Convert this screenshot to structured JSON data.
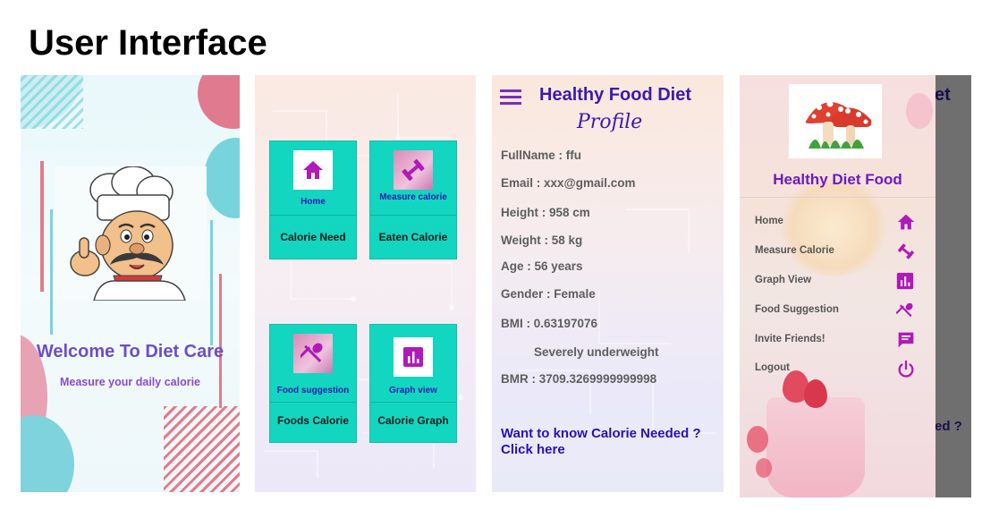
{
  "heading": "User Interface",
  "splash": {
    "welcome": "Welcome To Diet Care",
    "subtitle": "Measure your daily calorie",
    "image_icon": "chef-icon"
  },
  "dashboard": {
    "tiles": [
      {
        "icon": "home-icon",
        "label": "Home",
        "bottom": "Calorie Need"
      },
      {
        "icon": "dumbbell-icon",
        "label": "Measure calorie",
        "bottom": "Eaten Calorie"
      },
      {
        "icon": "fork-spoon-icon",
        "label": "Food suggestion",
        "bottom": "Foods Calorie"
      },
      {
        "icon": "bar-chart-icon",
        "label": "Graph view",
        "bottom": "Calorie Graph"
      }
    ],
    "tile_color": "#12d6c0"
  },
  "profile": {
    "app_title": "Healthy Food Diet",
    "page_title": "Profile",
    "fields": [
      "FullName : ffu",
      "Email :  xxx@gmail.com",
      "Height : 958 cm",
      "Weight : 58 kg",
      "Age : 56 years",
      "Gender :  Female",
      "BMI :  0.63197076",
      "Severely underweight",
      "BMR :  3709.3269999999998"
    ],
    "cta_line1": "Want to know Calorie Needed ?",
    "cta_line2": "Click here"
  },
  "drawer": {
    "logo_icon": "mushroom-icon",
    "title": "Healthy Diet Food",
    "items": [
      {
        "label": "Home",
        "icon": "home-icon"
      },
      {
        "label": "Measure Calorie",
        "icon": "dumbbell-icon"
      },
      {
        "label": "Graph View",
        "icon": "bar-chart-icon"
      },
      {
        "label": "Food Suggestion",
        "icon": "fork-spoon-icon"
      },
      {
        "label": "Invite Friends!",
        "icon": "message-icon"
      },
      {
        "label": "Logout",
        "icon": "power-icon"
      }
    ],
    "behind_title_fragment": "et",
    "behind_cta_fragment": "ed ?",
    "accent": "#b01ab8"
  }
}
